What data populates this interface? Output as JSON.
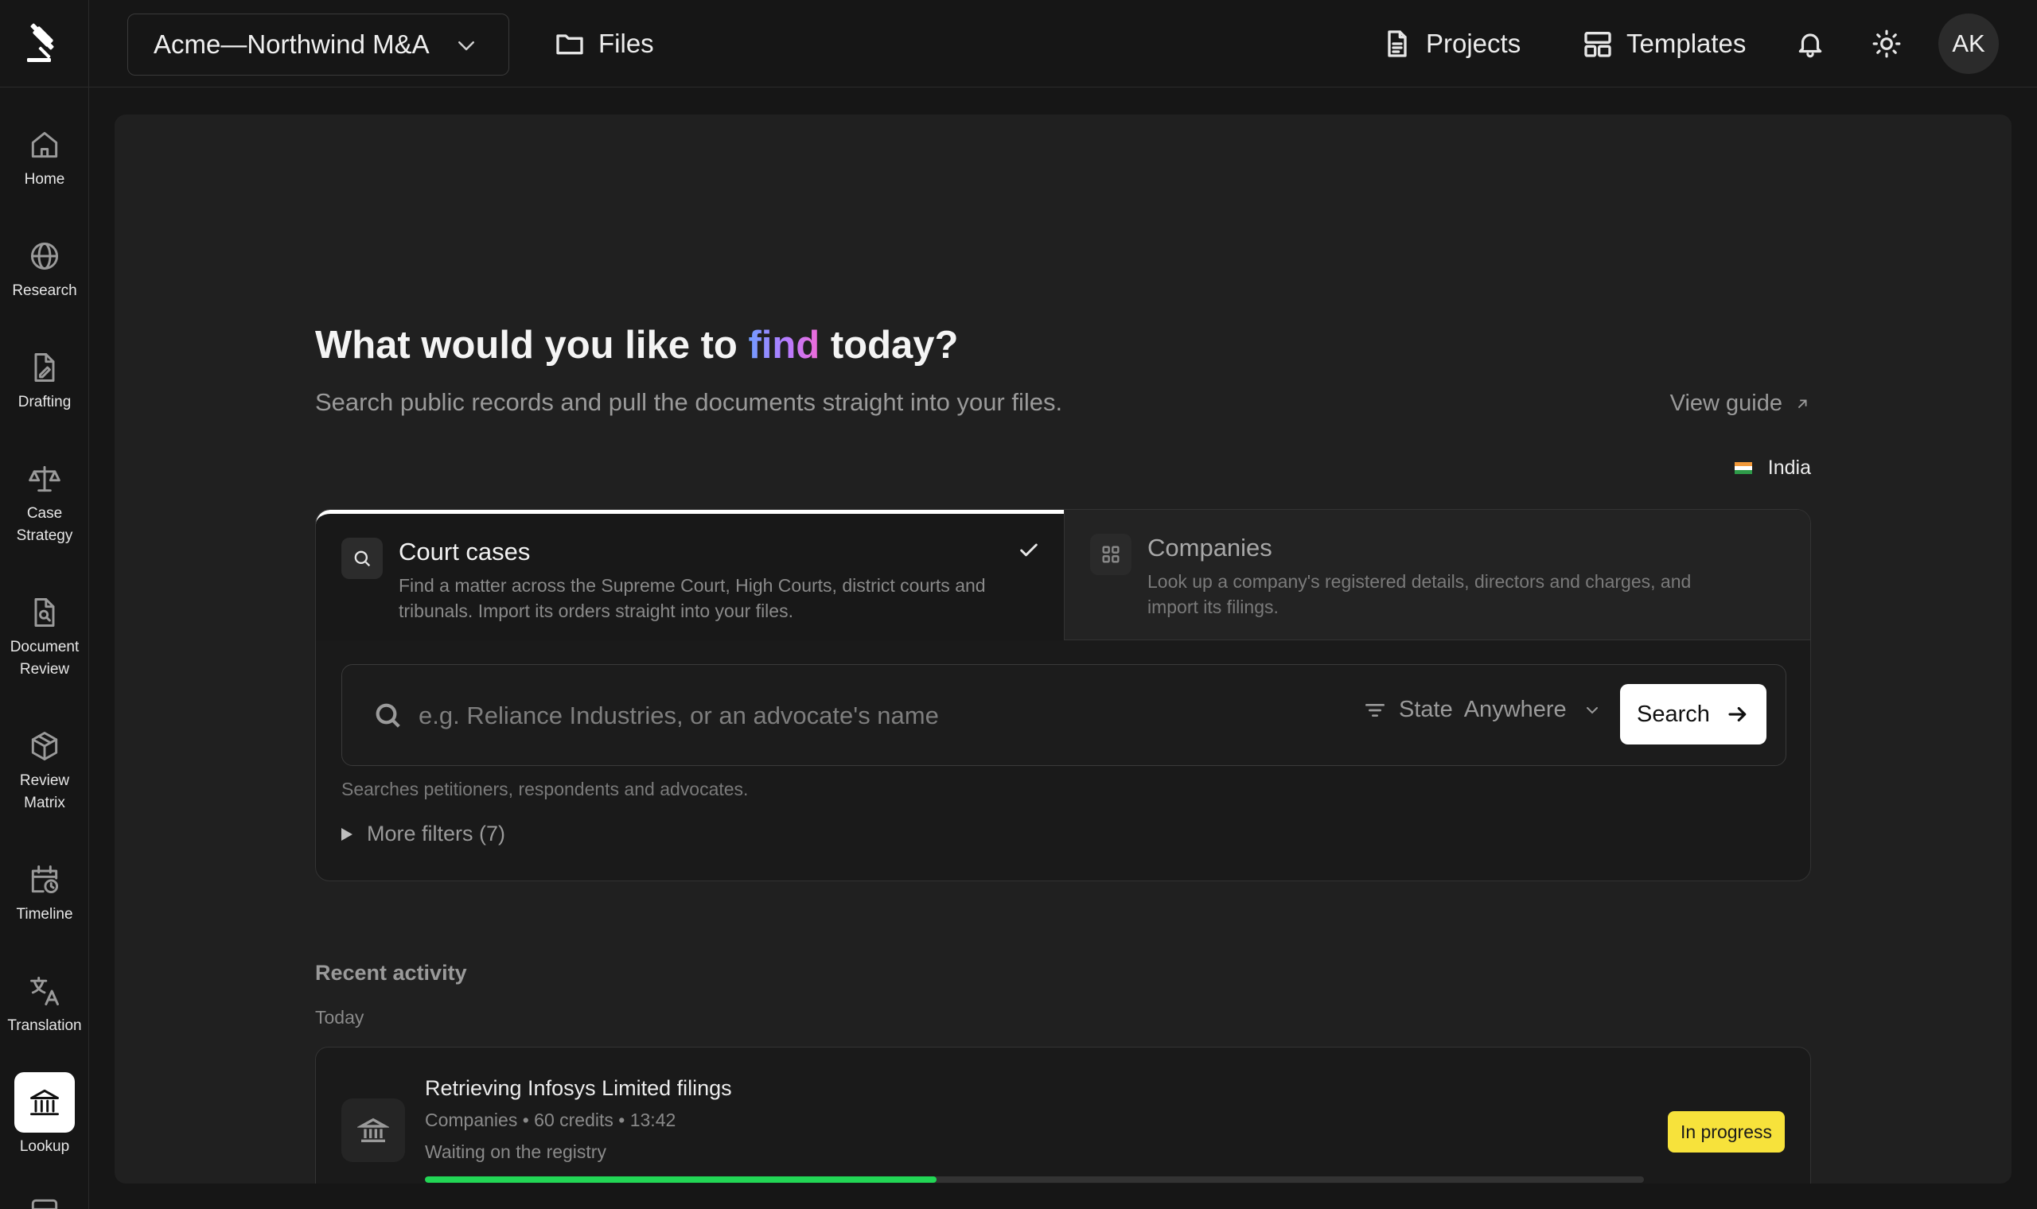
{
  "sidebar": {
    "items": [
      {
        "label": "Home",
        "icon": "home-icon"
      },
      {
        "label": "Research",
        "icon": "globe-icon"
      },
      {
        "label": "Drafting",
        "icon": "drafting-icon"
      },
      {
        "label": "Case Strategy",
        "icon": "scales-icon"
      },
      {
        "label": "Document Review",
        "icon": "document-search-icon"
      },
      {
        "label": "Review Matrix",
        "icon": "cube-icon"
      },
      {
        "label": "Timeline",
        "icon": "calendar-clock-icon"
      },
      {
        "label": "Translation",
        "icon": "translate-icon"
      },
      {
        "label": "Lookup",
        "icon": "bank-icon"
      }
    ]
  },
  "topbar": {
    "workspace": "Acme—Northwind M&A",
    "files": "Files",
    "projects": "Projects",
    "templates": "Templates",
    "avatar": "AK"
  },
  "main": {
    "title_before": "What would you like to ",
    "title_highlight": "find",
    "title_after": " today?",
    "subtitle": "Search public records and pull the documents straight into your files.",
    "view_guide": "View guide",
    "country": "India"
  },
  "tabs": {
    "court": {
      "title": "Court cases",
      "desc": "Find a matter across the Supreme Court, High Courts, district courts and tribunals. Import its orders straight into your files."
    },
    "companies": {
      "title": "Companies",
      "desc": "Look up a company's registered details, directors and charges, and import its filings."
    }
  },
  "search": {
    "placeholder": "e.g. Reliance Industries, or an advocate's name",
    "state_label": "State",
    "state_value": "Anywhere",
    "button": "Search",
    "hint": "Searches petitioners, respondents and advocates.",
    "more_filters": "More filters (7)"
  },
  "recent": {
    "heading": "Recent activity",
    "group": "Today",
    "items": [
      {
        "title": "Retrieving Infosys Limited filings",
        "meta": "Companies • 60 credits • 13:42",
        "status": "Waiting on the registry",
        "badge": "In progress",
        "progress": 0.42
      }
    ]
  },
  "colors": {
    "accent_gradient": [
      "#6f9cff",
      "#b77bff",
      "#f06bd8"
    ],
    "badge": "#f7e23b",
    "progress": "#22d655"
  }
}
